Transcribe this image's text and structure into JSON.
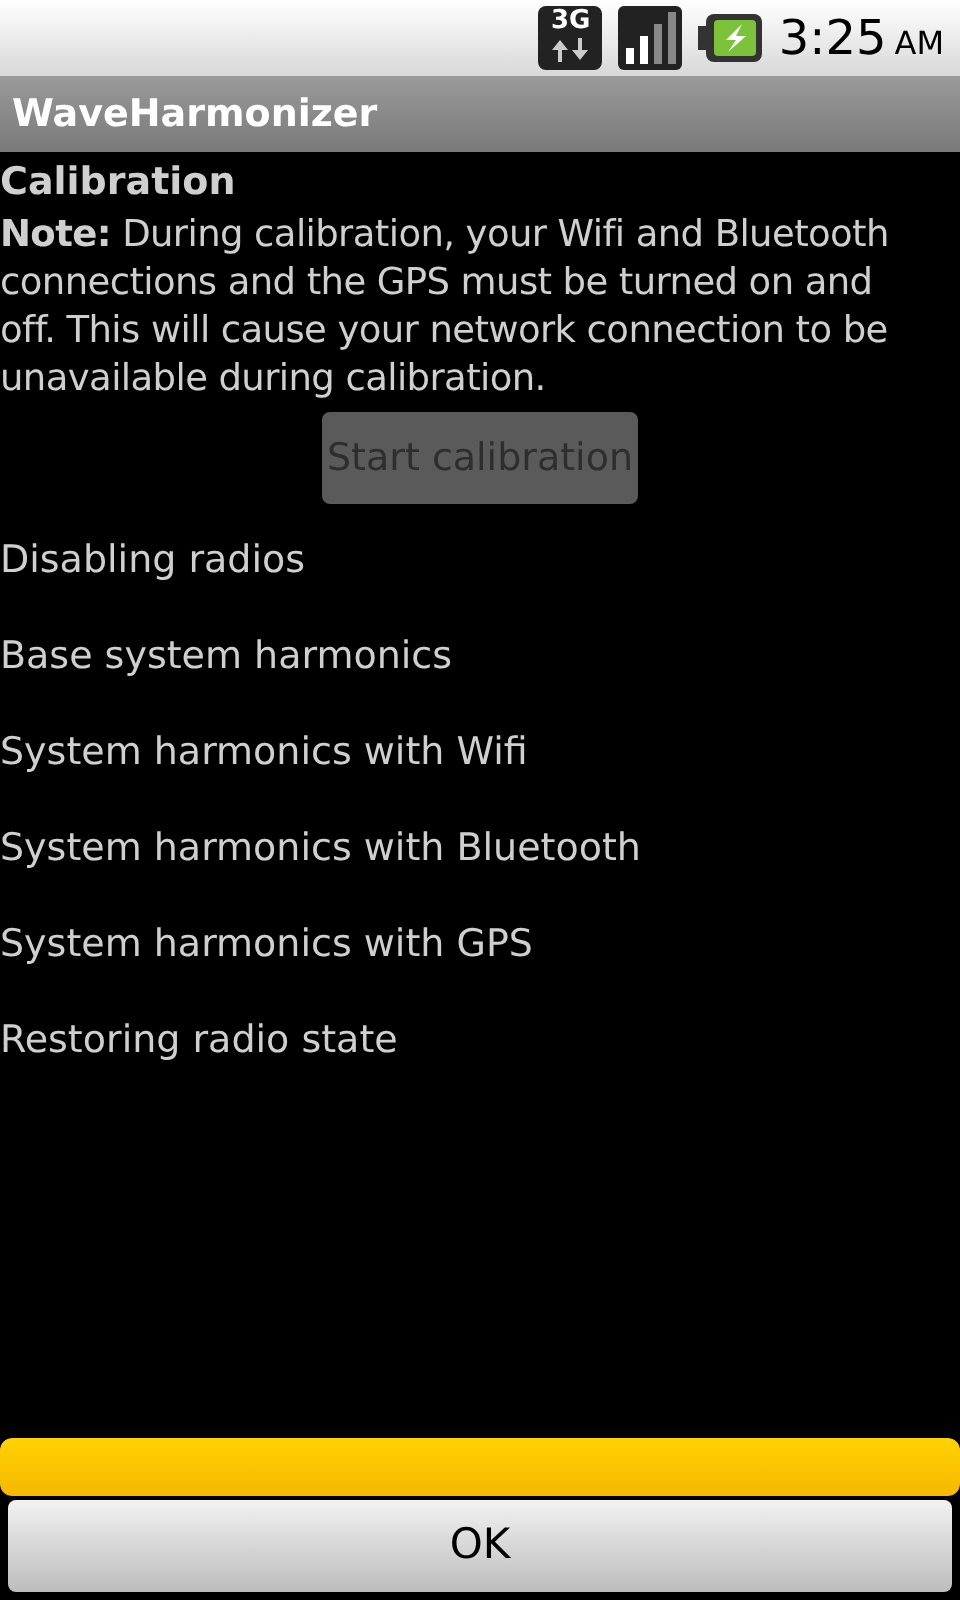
{
  "status_bar": {
    "network_type": "3G",
    "battery_charging": true,
    "time": "3:25",
    "meridiem": "AM"
  },
  "window": {
    "title": "WaveHarmonizer"
  },
  "heading": "Calibration",
  "note": "**Note:** During calibration, your Wifi and Bluetooth connections and the GPS must be turned on and off. This will cause your network connection to be unavailable during calibration.",
  "start_button": {
    "label": "Start calibration",
    "disabled": true
  },
  "steps": [
    {
      "label": "Disabling radios"
    },
    {
      "label": "Base system harmonics"
    },
    {
      "label": "System harmonics with Wifi"
    },
    {
      "label": "System harmonics with Bluetooth"
    },
    {
      "label": "System harmonics with GPS"
    },
    {
      "label": "Restoring radio state"
    }
  ],
  "progress": {
    "level": 1
  },
  "ok_button": {
    "label": "OK"
  }
}
